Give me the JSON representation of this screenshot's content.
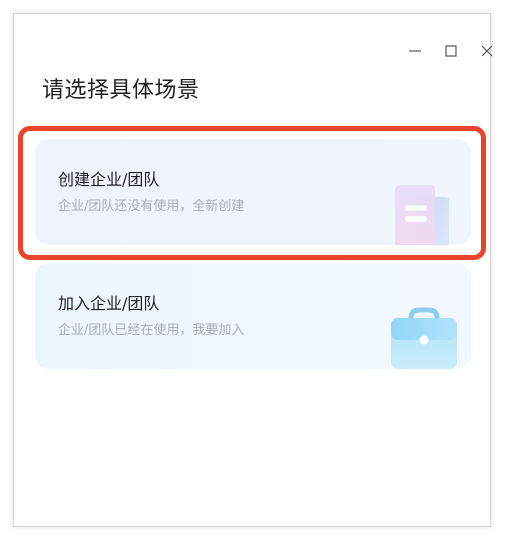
{
  "window": {
    "minimize_icon": "minimize-icon",
    "maximize_icon": "maximize-icon",
    "close_icon": "close-icon"
  },
  "page": {
    "title": "请选择具体场景"
  },
  "options": [
    {
      "title": "创建企业/团队",
      "description": "企业/团队还没有使用，全新创建",
      "icon": "document-stack-icon",
      "highlighted": true
    },
    {
      "title": "加入企业/团队",
      "description": "企业/团队已经在使用，我要加入",
      "icon": "briefcase-icon",
      "highlighted": false
    }
  ],
  "colors": {
    "highlight_border": "#e8432b",
    "title_text": "#1f1f1f",
    "description_text": "#a8acb3",
    "card_background": "#eef3fd"
  }
}
